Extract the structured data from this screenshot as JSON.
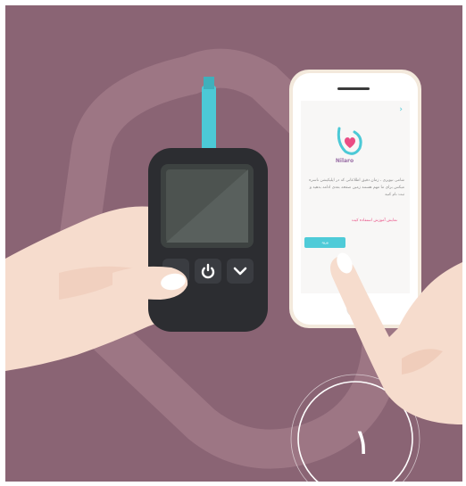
{
  "illustration": {
    "colors": {
      "background": "#8a6474",
      "ring": "#9e7886",
      "glucometer_body": "#2c2d31",
      "glucometer_screen": "#4d5350",
      "test_strip": "#4cc9d6",
      "phone_frame": "#f3e9dc",
      "phone_screen": "#f8f7f6",
      "accent": "#4fcbd8",
      "link": "#e94d84",
      "skin": "#f6dccd"
    },
    "glucometer": {
      "buttons": [
        "power-icon",
        "chevron-down-icon"
      ]
    },
    "phone": {
      "back_icon": "›",
      "brand": "Nilaro",
      "intro_text": "شامی تیوپری ، زمان دقیق اطلاعاتی که در اپلیکیشن ناسره میکس برای ما مهم هستند زمین صفحه بعدی ادامه بدهید و ثبت نام کنید",
      "link_text": "نمایش آموزش استفاده کیت",
      "login_button": "ورود"
    },
    "step_number": "١"
  }
}
